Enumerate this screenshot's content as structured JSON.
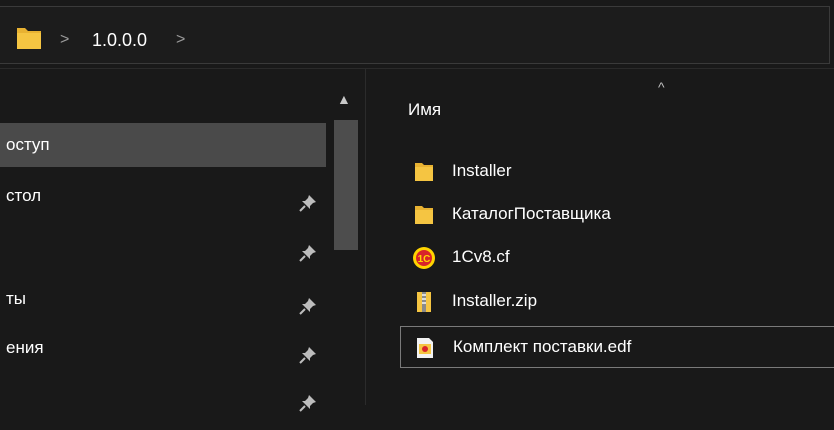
{
  "address_bar": {
    "location_icon": "folder-icon",
    "separator": ">",
    "crumb": "1.0.0.0"
  },
  "nav_pane": {
    "items": [
      {
        "label": "оступ",
        "pinned": false,
        "selected": true
      },
      {
        "label": "стол",
        "pinned": true,
        "selected": false
      },
      {
        "label": "",
        "pinned": true,
        "selected": false
      },
      {
        "label": "ты",
        "pinned": true,
        "selected": false
      },
      {
        "label": "ения",
        "pinned": true,
        "selected": false
      },
      {
        "label": "",
        "pinned": true,
        "selected": false
      }
    ]
  },
  "file_list": {
    "column_header": "Имя",
    "sort_indicator": "^",
    "items": [
      {
        "name": "Installer",
        "icon": "folder-icon"
      },
      {
        "name": "КаталогПоставщика",
        "icon": "folder-icon"
      },
      {
        "name": "1Cv8.cf",
        "icon": "1c-config-icon"
      },
      {
        "name": "Installer.zip",
        "icon": "zip-folder-icon"
      },
      {
        "name": "Комплект поставки.edf",
        "icon": "edf-file-icon",
        "focused": true
      }
    ]
  },
  "colors": {
    "background": "#191919",
    "selected": "#4a4a4a",
    "folder": "#f5c542",
    "onec_red": "#d8232a",
    "onec_yellow": "#ffd400"
  }
}
